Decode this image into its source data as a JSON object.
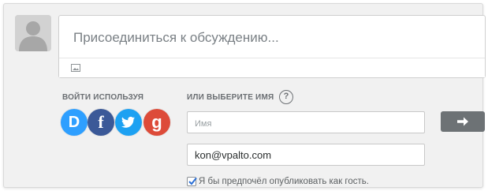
{
  "composer": {
    "placeholder": "Присоединиться к обсуждению..."
  },
  "login": {
    "label": "ВОЙТИ ИСПОЛЬЗУЯ",
    "providers": [
      {
        "id": "disqus",
        "glyph": "D",
        "color": "#2e9fff",
        "icon": "disqus-icon"
      },
      {
        "id": "facebook",
        "glyph": "f",
        "color": "#3b5998",
        "icon": "facebook-icon"
      },
      {
        "id": "twitter",
        "glyph": "",
        "color": "#1da1f2",
        "icon": "twitter-icon"
      },
      {
        "id": "google",
        "glyph": "g",
        "color": "#dd4b39",
        "icon": "google-icon"
      }
    ]
  },
  "guest": {
    "label": "ИЛИ ВЫБЕРИТЕ ИМЯ",
    "help_glyph": "?",
    "name_placeholder": "Имя",
    "email_value": "kon@vpalto.com",
    "guest_checkbox_checked": true,
    "guest_checkbox_label": "Я бы предпочёл опубликовать как гость."
  },
  "colors": {
    "panel_bg": "#f1f1f1",
    "submit_button": "#6d7275",
    "checkbox_check": "#2a6fd6"
  }
}
